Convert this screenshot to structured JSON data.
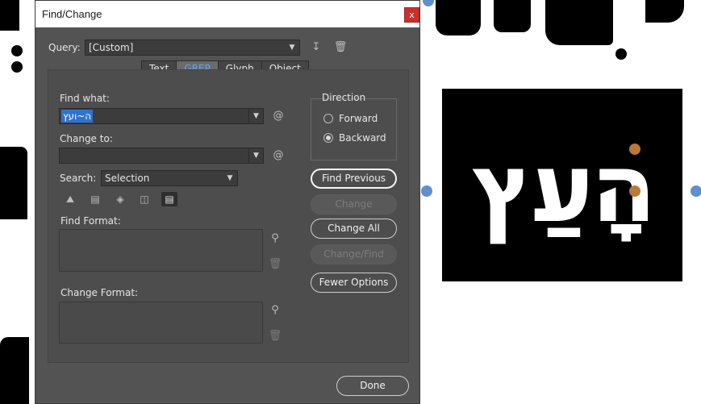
{
  "dialog": {
    "title": "Find/Change",
    "close_glyph": "x",
    "query": {
      "label": "Query:",
      "value": "[Custom]"
    },
    "tabs": [
      {
        "label": "Text",
        "active": false
      },
      {
        "label": "GREP",
        "active": true
      },
      {
        "label": "Glyph",
        "active": false
      },
      {
        "label": "Object",
        "active": false
      }
    ],
    "find_what": {
      "label": "Find what:",
      "value": "ה~ועץ",
      "special_char_icon": "@"
    },
    "change_to": {
      "label": "Change to:",
      "value": "",
      "special_char_icon": "@"
    },
    "search": {
      "label": "Search:",
      "value": "Selection"
    },
    "find_format": {
      "label": "Find Format:"
    },
    "change_format": {
      "label": "Change Format:"
    },
    "direction": {
      "label": "Direction",
      "options": [
        {
          "label": "Forward",
          "selected": false
        },
        {
          "label": "Backward",
          "selected": true
        }
      ]
    },
    "buttons": {
      "find_previous": "Find Previous",
      "change": "Change",
      "change_all": "Change All",
      "change_find": "Change/Find",
      "fewer_options": "Fewer Options",
      "done": "Done"
    }
  },
  "canvas": {
    "frame_text": "הָעַץ"
  },
  "colors": {
    "dialog_bg": "#535353",
    "selection_highlight": "#2f73d0",
    "active_tab_text": "#5aa6ff",
    "close_button": "#c9302c",
    "handle": "#5f8fcf",
    "anchor": "#b8793a"
  }
}
